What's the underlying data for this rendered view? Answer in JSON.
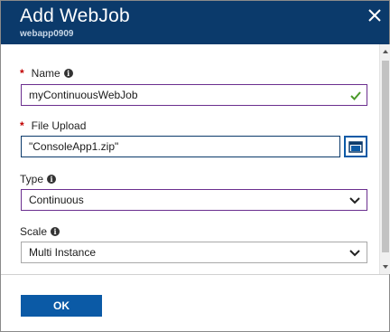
{
  "header": {
    "title": "Add WebJob",
    "subtitle": "webapp0909"
  },
  "fields": {
    "name": {
      "label": "Name",
      "required": true,
      "value": "myContinuousWebJob",
      "valid": true
    },
    "file_upload": {
      "label": "File Upload",
      "required": true,
      "value": "\"ConsoleApp1.zip\""
    },
    "type": {
      "label": "Type",
      "value": "Continuous"
    },
    "scale": {
      "label": "Scale",
      "value": "Multi Instance"
    }
  },
  "footer": {
    "ok_label": "OK"
  },
  "icons": {
    "close": "close-icon",
    "info": "info-icon",
    "check": "check-icon",
    "browse": "folder-browse-icon",
    "dropdown": "chevron-down-icon"
  },
  "colors": {
    "header_bg": "#0b3a6b",
    "accent": "#0b5aa6",
    "required_star": "#c00000",
    "valid_check": "#4b9a2a",
    "focused_border": "#6b2f8f"
  }
}
